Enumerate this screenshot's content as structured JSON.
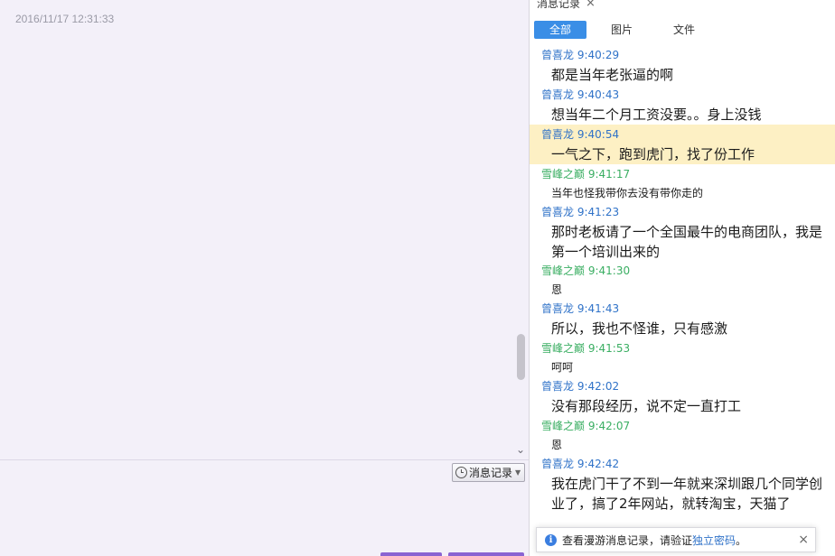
{
  "left": {
    "timestamp": "2016/11/17 12:31:33",
    "history_button": "消息记录",
    "scroll_down_icon": "chevron-down"
  },
  "panel": {
    "tab_title": "消息记录",
    "tab_close": "×",
    "filters": [
      "全部",
      "图片",
      "文件"
    ],
    "active_filter": "全部"
  },
  "messages": [
    {
      "sender": "曾喜龙",
      "time": "9:40:29",
      "text": "都是当年老张逼的啊",
      "color": "blue",
      "size": "big"
    },
    {
      "sender": "曾喜龙",
      "time": "9:40:43",
      "text": "想当年二个月工资没要。。身上没钱",
      "color": "blue",
      "size": "big"
    },
    {
      "sender": "曾喜龙",
      "time": "9:40:54",
      "text": "一气之下，跑到虎门，找了份工作",
      "color": "blue",
      "size": "big",
      "highlight": true
    },
    {
      "sender": "雪峰之巅",
      "time": "9:41:17",
      "text": "当年也怪我带你去没有带你走的",
      "color": "green",
      "size": "small"
    },
    {
      "sender": "曾喜龙",
      "time": "9:41:23",
      "text": "那时老板请了一个全国最牛的电商团队，我是第一个培训出来的",
      "color": "blue",
      "size": "big"
    },
    {
      "sender": "雪峰之巅",
      "time": "9:41:30",
      "text": "恩",
      "color": "green",
      "size": "small"
    },
    {
      "sender": "曾喜龙",
      "time": "9:41:43",
      "text": "所以，我也不怪谁，只有感激",
      "color": "blue",
      "size": "big"
    },
    {
      "sender": "雪峰之巅",
      "time": "9:41:53",
      "text": "呵呵",
      "color": "green",
      "size": "small"
    },
    {
      "sender": "曾喜龙",
      "time": "9:42:02",
      "text": "没有那段经历，说不定一直打工",
      "color": "blue",
      "size": "big"
    },
    {
      "sender": "雪峰之巅",
      "time": "9:42:07",
      "text": "恩",
      "color": "green",
      "size": "small"
    },
    {
      "sender": "曾喜龙",
      "time": "9:42:42",
      "text": "我在虎门干了不到一年就来深圳跟几个同学创业了，搞了2年网站，就转淘宝，天猫了",
      "color": "blue",
      "size": "big"
    }
  ],
  "notice": {
    "text_before": "查看漫游消息记录，请验证",
    "link": "独立密码",
    "text_after": "。",
    "close": "×"
  },
  "colors": {
    "accent": "#3a8ee6",
    "sender_blue": "#2f72c8",
    "sender_green": "#3aae62",
    "highlight": "#fdf0c4"
  }
}
